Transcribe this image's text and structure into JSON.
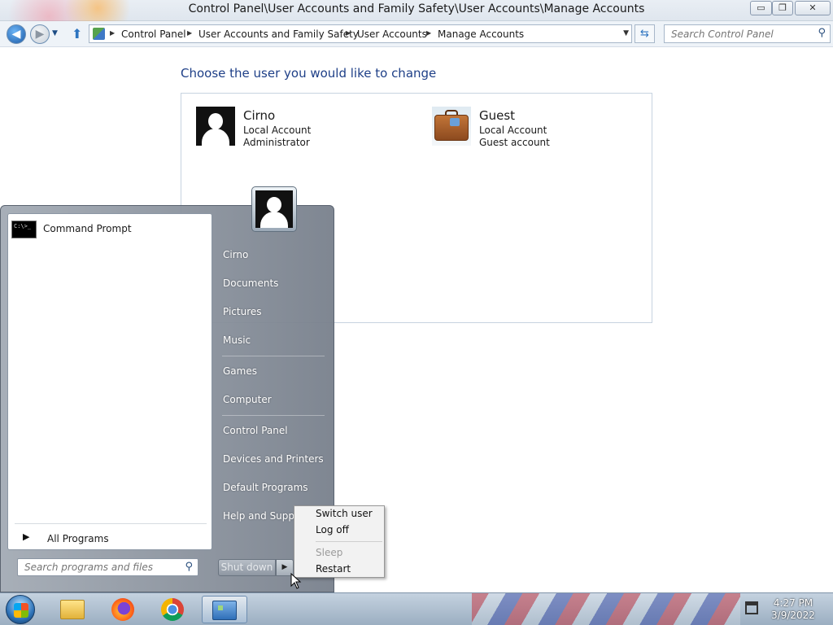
{
  "window": {
    "title": "Control Panel\\User Accounts and Family Safety\\User Accounts\\Manage Accounts",
    "controls": {
      "minimize": "▭",
      "maximize": "❐",
      "close": "✕"
    }
  },
  "address": {
    "breadcrumbs": [
      "Control Panel",
      "User Accounts and Family Safety",
      "User Accounts",
      "Manage Accounts"
    ],
    "search_placeholder": "Search Control Panel"
  },
  "content": {
    "heading": "Choose the user you would like to change",
    "users": [
      {
        "name": "Cirno",
        "line1": "Local Account",
        "line2": "Administrator"
      },
      {
        "name": "Guest",
        "line1": "Local Account",
        "line2": "Guest account"
      }
    ]
  },
  "start_menu": {
    "pinned": [
      {
        "label": "Command Prompt",
        "icon_text": "C:\\>_"
      }
    ],
    "all_programs": "All Programs",
    "search_placeholder": "Search programs and files",
    "right_items": [
      "Cirno",
      "Documents",
      "Pictures",
      "Music",
      "Games",
      "Computer",
      "Control Panel",
      "Devices and Printers",
      "Default Programs",
      "Help and Support"
    ],
    "shutdown_label": "Shut down",
    "power_menu": [
      {
        "label": "Switch user",
        "enabled": true
      },
      {
        "label": "Log off",
        "enabled": true
      },
      {
        "label": "Sleep",
        "enabled": false
      },
      {
        "label": "Restart",
        "enabled": true
      }
    ]
  },
  "taskbar": {
    "pinned_icons": [
      "windows-explorer-icon",
      "firefox-icon",
      "chrome-icon",
      "control-panel-icon"
    ],
    "time": "4:27 PM",
    "date": "3/9/2022"
  }
}
